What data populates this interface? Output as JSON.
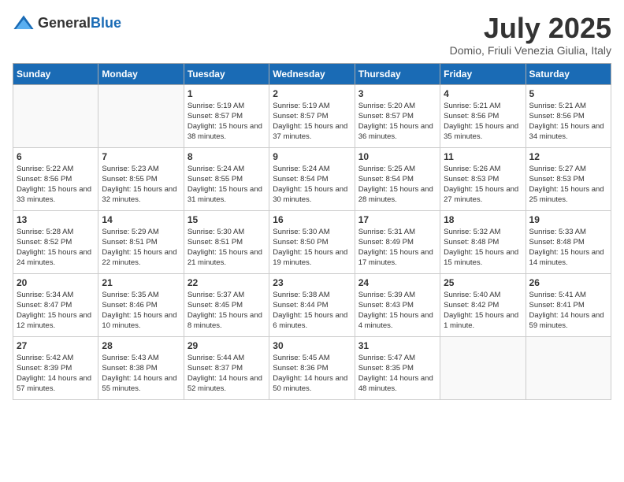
{
  "logo": {
    "general": "General",
    "blue": "Blue"
  },
  "title": {
    "month": "July 2025",
    "location": "Domio, Friuli Venezia Giulia, Italy"
  },
  "headers": [
    "Sunday",
    "Monday",
    "Tuesday",
    "Wednesday",
    "Thursday",
    "Friday",
    "Saturday"
  ],
  "weeks": [
    [
      {
        "day": "",
        "info": ""
      },
      {
        "day": "",
        "info": ""
      },
      {
        "day": "1",
        "info": "Sunrise: 5:19 AM\nSunset: 8:57 PM\nDaylight: 15 hours and 38 minutes."
      },
      {
        "day": "2",
        "info": "Sunrise: 5:19 AM\nSunset: 8:57 PM\nDaylight: 15 hours and 37 minutes."
      },
      {
        "day": "3",
        "info": "Sunrise: 5:20 AM\nSunset: 8:57 PM\nDaylight: 15 hours and 36 minutes."
      },
      {
        "day": "4",
        "info": "Sunrise: 5:21 AM\nSunset: 8:56 PM\nDaylight: 15 hours and 35 minutes."
      },
      {
        "day": "5",
        "info": "Sunrise: 5:21 AM\nSunset: 8:56 PM\nDaylight: 15 hours and 34 minutes."
      }
    ],
    [
      {
        "day": "6",
        "info": "Sunrise: 5:22 AM\nSunset: 8:56 PM\nDaylight: 15 hours and 33 minutes."
      },
      {
        "day": "7",
        "info": "Sunrise: 5:23 AM\nSunset: 8:55 PM\nDaylight: 15 hours and 32 minutes."
      },
      {
        "day": "8",
        "info": "Sunrise: 5:24 AM\nSunset: 8:55 PM\nDaylight: 15 hours and 31 minutes."
      },
      {
        "day": "9",
        "info": "Sunrise: 5:24 AM\nSunset: 8:54 PM\nDaylight: 15 hours and 30 minutes."
      },
      {
        "day": "10",
        "info": "Sunrise: 5:25 AM\nSunset: 8:54 PM\nDaylight: 15 hours and 28 minutes."
      },
      {
        "day": "11",
        "info": "Sunrise: 5:26 AM\nSunset: 8:53 PM\nDaylight: 15 hours and 27 minutes."
      },
      {
        "day": "12",
        "info": "Sunrise: 5:27 AM\nSunset: 8:53 PM\nDaylight: 15 hours and 25 minutes."
      }
    ],
    [
      {
        "day": "13",
        "info": "Sunrise: 5:28 AM\nSunset: 8:52 PM\nDaylight: 15 hours and 24 minutes."
      },
      {
        "day": "14",
        "info": "Sunrise: 5:29 AM\nSunset: 8:51 PM\nDaylight: 15 hours and 22 minutes."
      },
      {
        "day": "15",
        "info": "Sunrise: 5:30 AM\nSunset: 8:51 PM\nDaylight: 15 hours and 21 minutes."
      },
      {
        "day": "16",
        "info": "Sunrise: 5:30 AM\nSunset: 8:50 PM\nDaylight: 15 hours and 19 minutes."
      },
      {
        "day": "17",
        "info": "Sunrise: 5:31 AM\nSunset: 8:49 PM\nDaylight: 15 hours and 17 minutes."
      },
      {
        "day": "18",
        "info": "Sunrise: 5:32 AM\nSunset: 8:48 PM\nDaylight: 15 hours and 15 minutes."
      },
      {
        "day": "19",
        "info": "Sunrise: 5:33 AM\nSunset: 8:48 PM\nDaylight: 15 hours and 14 minutes."
      }
    ],
    [
      {
        "day": "20",
        "info": "Sunrise: 5:34 AM\nSunset: 8:47 PM\nDaylight: 15 hours and 12 minutes."
      },
      {
        "day": "21",
        "info": "Sunrise: 5:35 AM\nSunset: 8:46 PM\nDaylight: 15 hours and 10 minutes."
      },
      {
        "day": "22",
        "info": "Sunrise: 5:37 AM\nSunset: 8:45 PM\nDaylight: 15 hours and 8 minutes."
      },
      {
        "day": "23",
        "info": "Sunrise: 5:38 AM\nSunset: 8:44 PM\nDaylight: 15 hours and 6 minutes."
      },
      {
        "day": "24",
        "info": "Sunrise: 5:39 AM\nSunset: 8:43 PM\nDaylight: 15 hours and 4 minutes."
      },
      {
        "day": "25",
        "info": "Sunrise: 5:40 AM\nSunset: 8:42 PM\nDaylight: 15 hours and 1 minute."
      },
      {
        "day": "26",
        "info": "Sunrise: 5:41 AM\nSunset: 8:41 PM\nDaylight: 14 hours and 59 minutes."
      }
    ],
    [
      {
        "day": "27",
        "info": "Sunrise: 5:42 AM\nSunset: 8:39 PM\nDaylight: 14 hours and 57 minutes."
      },
      {
        "day": "28",
        "info": "Sunrise: 5:43 AM\nSunset: 8:38 PM\nDaylight: 14 hours and 55 minutes."
      },
      {
        "day": "29",
        "info": "Sunrise: 5:44 AM\nSunset: 8:37 PM\nDaylight: 14 hours and 52 minutes."
      },
      {
        "day": "30",
        "info": "Sunrise: 5:45 AM\nSunset: 8:36 PM\nDaylight: 14 hours and 50 minutes."
      },
      {
        "day": "31",
        "info": "Sunrise: 5:47 AM\nSunset: 8:35 PM\nDaylight: 14 hours and 48 minutes."
      },
      {
        "day": "",
        "info": ""
      },
      {
        "day": "",
        "info": ""
      }
    ]
  ]
}
